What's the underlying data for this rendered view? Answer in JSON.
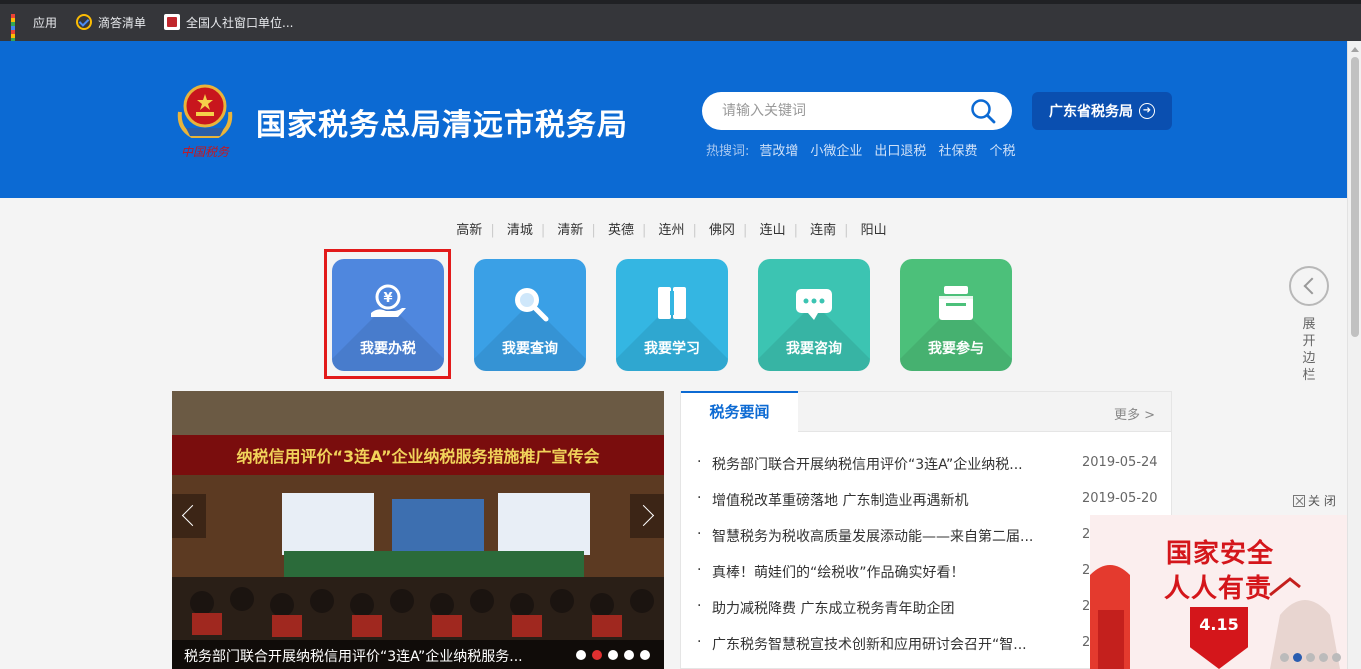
{
  "bookmarks": [
    {
      "label": "应用",
      "icon": "apps-grid-icon"
    },
    {
      "label": "滴答清单",
      "icon": "checkmark-icon"
    },
    {
      "label": "全国人社窗口单位...",
      "icon": "rs-logo-icon"
    }
  ],
  "header": {
    "title": "国家税务总局清远市税务局",
    "logo_text": "中国税务",
    "search_placeholder": "请输入关键词",
    "province_button": "广东省税务局",
    "hot_label": "热搜词:",
    "hot_words": [
      "营改增",
      "小微企业",
      "出口退税",
      "社保费",
      "个税"
    ]
  },
  "districts": [
    "高新",
    "清城",
    "清新",
    "英德",
    "连州",
    "佛冈",
    "连山",
    "连南",
    "阳山"
  ],
  "services": [
    {
      "label": "我要办税",
      "color": "#4f87de",
      "icon": "tax-payment-icon"
    },
    {
      "label": "我要查询",
      "color": "#3aa0e6",
      "icon": "magnifier-icon"
    },
    {
      "label": "我要学习",
      "color": "#34b6e2",
      "icon": "book-icon"
    },
    {
      "label": "我要咨询",
      "color": "#3cc4b2",
      "icon": "chat-bubble-icon"
    },
    {
      "label": "我要参与",
      "color": "#4cc07a",
      "icon": "ballot-box-icon"
    }
  ],
  "sidebar": {
    "label": "展开边栏"
  },
  "carousel": {
    "banner_text": "纳税信用评价“3连A”企业纳税服务措施推广宣传会",
    "caption": "税务部门联合开展纳税信用评价“3连A”企业纳税服务...",
    "dots": 5,
    "active_dot": 1
  },
  "news": {
    "tab": "税务要闻",
    "more": "更多 >",
    "items": [
      {
        "title": "税务部门联合开展纳税信用评价“3连A”企业纳税...",
        "date": "2019-05-24"
      },
      {
        "title": "增值税改革重磅落地 广东制造业再遇新机",
        "date": "2019-05-20"
      },
      {
        "title": "智慧税务为税收高质量发展添动能——来自第二届...",
        "date": "2"
      },
      {
        "title": "真棒！萌娃们的“绘税收”作品确实好看！",
        "date": "2"
      },
      {
        "title": "助力减税降费 广东成立税务青年助企团",
        "date": "2"
      },
      {
        "title": "广东税务智慧税宣技术创新和应用研讨会召开“智...",
        "date": "2"
      }
    ]
  },
  "ad": {
    "close_label": "关 闭",
    "line1": "国家安全",
    "line2": "人人有责",
    "badge": "4.15"
  },
  "colors": {
    "header_blue": "#0c6ad3",
    "highlight_red": "#e21a1a",
    "ad_red": "#d4161b"
  }
}
